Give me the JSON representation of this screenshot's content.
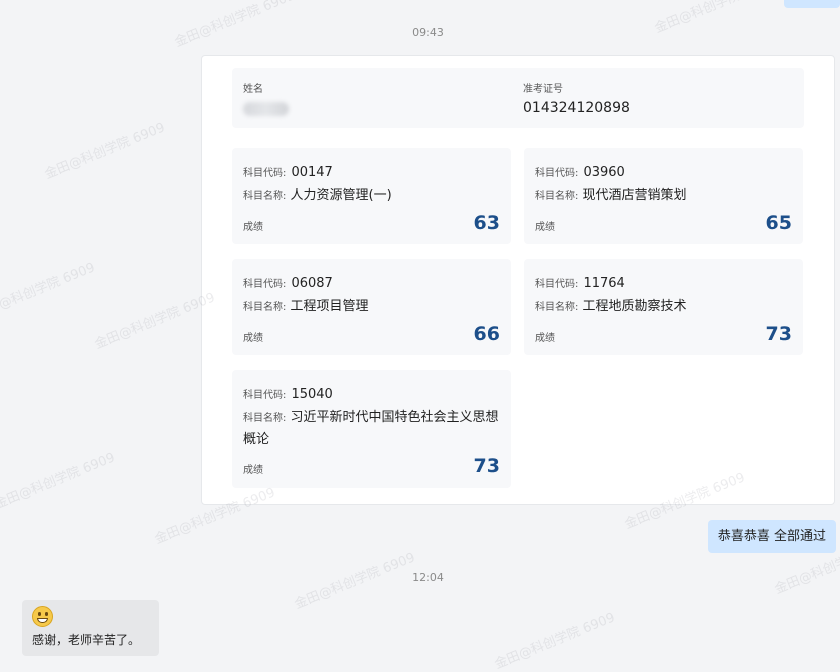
{
  "timestamps": [
    "09:43",
    "12:04"
  ],
  "info": {
    "name_label": "姓名",
    "ticket_label": "准考证号",
    "ticket_value": "014324120898"
  },
  "labels": {
    "code": "科目代码:",
    "name": "科目名称:",
    "score": "成绩"
  },
  "subjects": [
    {
      "code": "00147",
      "name": "人力资源管理(一)",
      "score": "63"
    },
    {
      "code": "03960",
      "name": "现代酒店营销策划",
      "score": "65"
    },
    {
      "code": "06087",
      "name": "工程项目管理",
      "score": "66"
    },
    {
      "code": "11764",
      "name": "工程地质勘察技术",
      "score": "73"
    },
    {
      "code": "15040",
      "name": "习近平新时代中国特色社会主义思想概论",
      "score": "73"
    }
  ],
  "messages": {
    "outgoing": "恭喜恭喜   全部通过",
    "incoming": "感谢，老师辛苦了。",
    "incoming_emoji": "grinning-face-icon"
  },
  "watermark": "金田@科创学院 6909"
}
